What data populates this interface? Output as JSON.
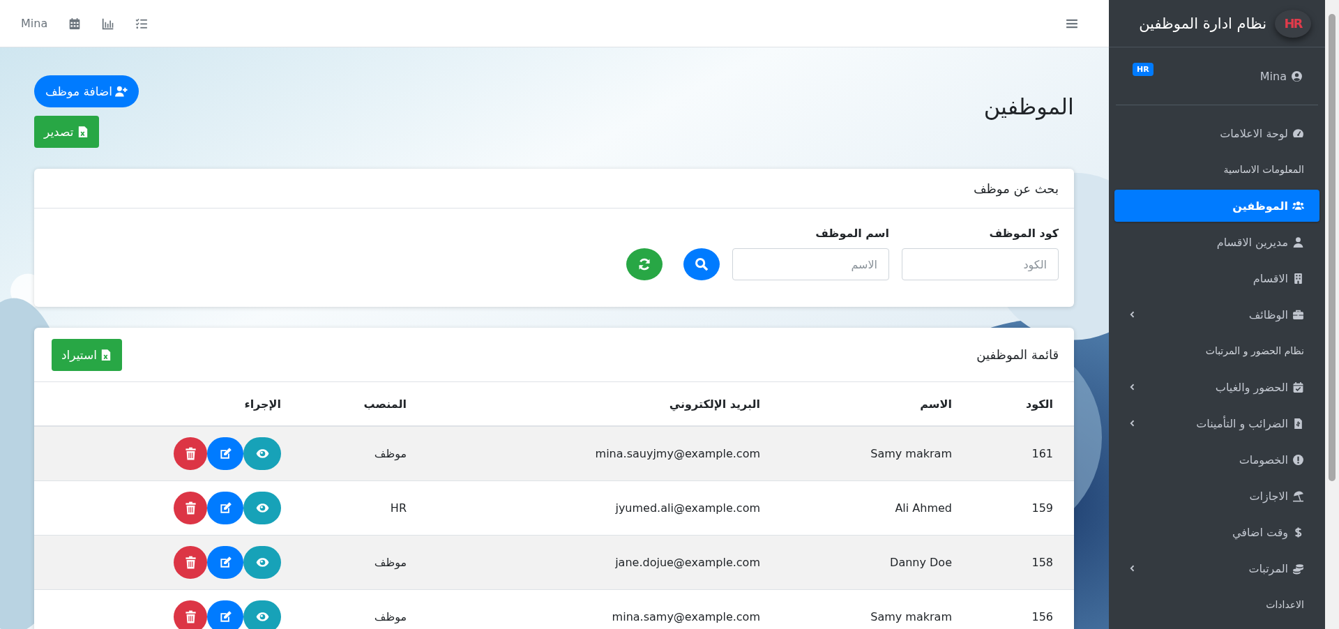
{
  "topbar": {
    "user": "Mina"
  },
  "page": {
    "title": "الموظفين",
    "add_button": "اضافة موظف",
    "export_button": "تصدير"
  },
  "search": {
    "title": "بحث عن موظف",
    "fields": [
      {
        "label": "كود الموظف",
        "placeholder": "الكود"
      },
      {
        "label": "اسم الموظف",
        "placeholder": "الاسم"
      }
    ]
  },
  "list": {
    "title": "قائمة الموظفين",
    "import_button": "استيراد",
    "columns": [
      "الكود",
      "الاسم",
      "البريد الإلكتروني",
      "المنصب",
      "الإجراء"
    ],
    "rows": [
      {
        "code": "161",
        "name": "Samy makram",
        "email": "mina.sauyjmy@example.com",
        "position": "موظف"
      },
      {
        "code": "159",
        "name": "Ali Ahmed",
        "email": "jyumed.ali@example.com",
        "position": "HR"
      },
      {
        "code": "158",
        "name": "Danny Doe",
        "email": "jane.dojue@example.com",
        "position": "موظف"
      },
      {
        "code": "156",
        "name": "Samy makram",
        "email": "mina.samy@example.com",
        "position": "موظف"
      }
    ]
  },
  "sidebar": {
    "logo": "HR",
    "title": "نظام ادارة الموظفين",
    "user": {
      "name": "Mina",
      "badge": "HR"
    },
    "items": [
      {
        "kind": "link",
        "label": "لوحة الاعلامات",
        "selected": false
      },
      {
        "kind": "header",
        "label": "المعلومات الاساسية"
      },
      {
        "kind": "link",
        "label": "الموظفين",
        "selected": true
      },
      {
        "kind": "link",
        "label": "مديرين الاقسام",
        "selected": false
      },
      {
        "kind": "link",
        "label": "الاقسام",
        "selected": false
      },
      {
        "kind": "menu",
        "label": "الوظائف",
        "selected": false,
        "expanded": false
      },
      {
        "kind": "header",
        "label": "نظام الحضور و المرتبات"
      },
      {
        "kind": "menu",
        "label": "الحضور والغياب",
        "selected": false,
        "expanded": false
      },
      {
        "kind": "menu",
        "label": "الضرائب و التأمينات",
        "selected": false,
        "expanded": false
      },
      {
        "kind": "link",
        "label": "الخصومات",
        "selected": false
      },
      {
        "kind": "link",
        "label": "الاجازات",
        "selected": false
      },
      {
        "kind": "link",
        "label": "وقت اضافي",
        "selected": false
      },
      {
        "kind": "menu",
        "label": "المرتبات",
        "selected": false,
        "expanded": false
      },
      {
        "kind": "header",
        "label": "الاعدادات"
      }
    ]
  }
}
